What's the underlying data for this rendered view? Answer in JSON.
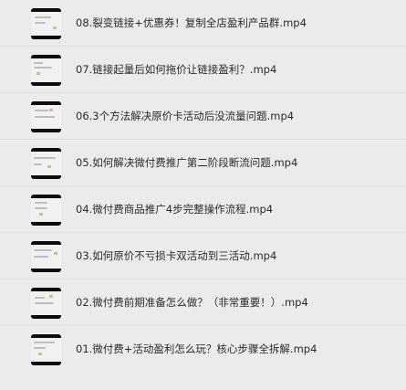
{
  "files": [
    {
      "name": "08.裂变链接+优惠券！复制全店盈利产品群.mp4",
      "thumbnail_icon": "video-thumbnail-icon"
    },
    {
      "name": "07.链接起量后如何拖价让链接盈利？.mp4",
      "thumbnail_icon": "video-thumbnail-icon"
    },
    {
      "name": "06.3个方法解决原价卡活动后没流量问题.mp4",
      "thumbnail_icon": "video-thumbnail-icon"
    },
    {
      "name": "05.如何解决微付费推广第二阶段断流问题.mp4",
      "thumbnail_icon": "video-thumbnail-icon"
    },
    {
      "name": "04.微付费商品推广4步完整操作流程.mp4",
      "thumbnail_icon": "video-thumbnail-icon"
    },
    {
      "name": "03.如何原价不亏损卡双活动到三活动.mp4",
      "thumbnail_icon": "video-thumbnail-icon"
    },
    {
      "name": "02.微付费前期准备怎么做？（非常重要！）.mp4",
      "thumbnail_icon": "video-thumbnail-icon"
    },
    {
      "name": "01.微付费+活动盈利怎么玩？核心步骤全拆解.mp4",
      "thumbnail_icon": "video-thumbnail-icon"
    }
  ],
  "colors": {
    "background": "#ebebeb",
    "thumbnail": "#0d0d0d",
    "text": "#2a2a2a",
    "divider": "#dedede"
  }
}
